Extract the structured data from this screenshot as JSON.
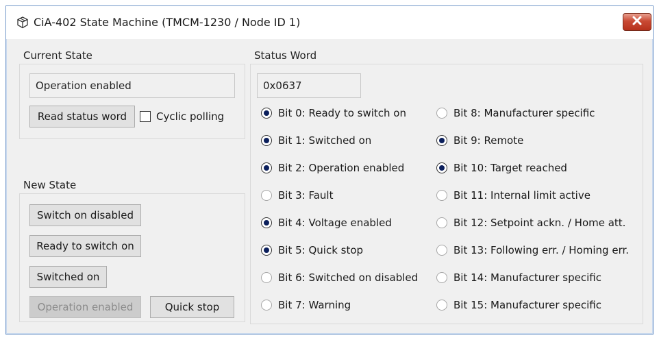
{
  "window": {
    "title": "CiA-402 State Machine (TMCM-1230 / Node ID  1)",
    "close_icon": "close-x-icon",
    "title_icon": "package-icon"
  },
  "current_state": {
    "group_title": "Current State",
    "state_value": "Operation enabled",
    "read_button": "Read status word",
    "cyclic_polling_label": "Cyclic polling",
    "cyclic_polling_checked": false
  },
  "new_state": {
    "group_title": "New State",
    "buttons": [
      {
        "label": "Switch on disabled",
        "enabled": true
      },
      {
        "label": "Ready to switch on",
        "enabled": true
      },
      {
        "label": "Switched on",
        "enabled": true
      },
      {
        "label": "Operation enabled",
        "enabled": false
      },
      {
        "label": "Quick stop",
        "enabled": true
      }
    ]
  },
  "status_word": {
    "group_title": "Status Word",
    "value": "0x0637",
    "bits": [
      {
        "label": "Bit 0: Ready to switch on",
        "set": true
      },
      {
        "label": "Bit 1: Switched on",
        "set": true
      },
      {
        "label": "Bit 2: Operation enabled",
        "set": true
      },
      {
        "label": "Bit 3: Fault",
        "set": false
      },
      {
        "label": "Bit 4: Voltage enabled",
        "set": true
      },
      {
        "label": "Bit 5: Quick stop",
        "set": true
      },
      {
        "label": "Bit 6: Switched on disabled",
        "set": false
      },
      {
        "label": "Bit 7: Warning",
        "set": false
      },
      {
        "label": "Bit 8: Manufacturer specific",
        "set": false
      },
      {
        "label": "Bit 9: Remote",
        "set": true
      },
      {
        "label": "Bit 10: Target reached",
        "set": true
      },
      {
        "label": "Bit 11: Internal limit active",
        "set": false
      },
      {
        "label": "Bit 12: Setpoint ackn. / Home att.",
        "set": false
      },
      {
        "label": "Bit 13: Following err. / Homing err.",
        "set": false
      },
      {
        "label": "Bit 14: Manufacturer specific",
        "set": false
      },
      {
        "label": "Bit 15: Manufacturer specific",
        "set": false
      }
    ]
  },
  "colors": {
    "window_border": "#6f96c8",
    "radio_dot": "#0b1f5c",
    "close_button": "#c94a34"
  }
}
